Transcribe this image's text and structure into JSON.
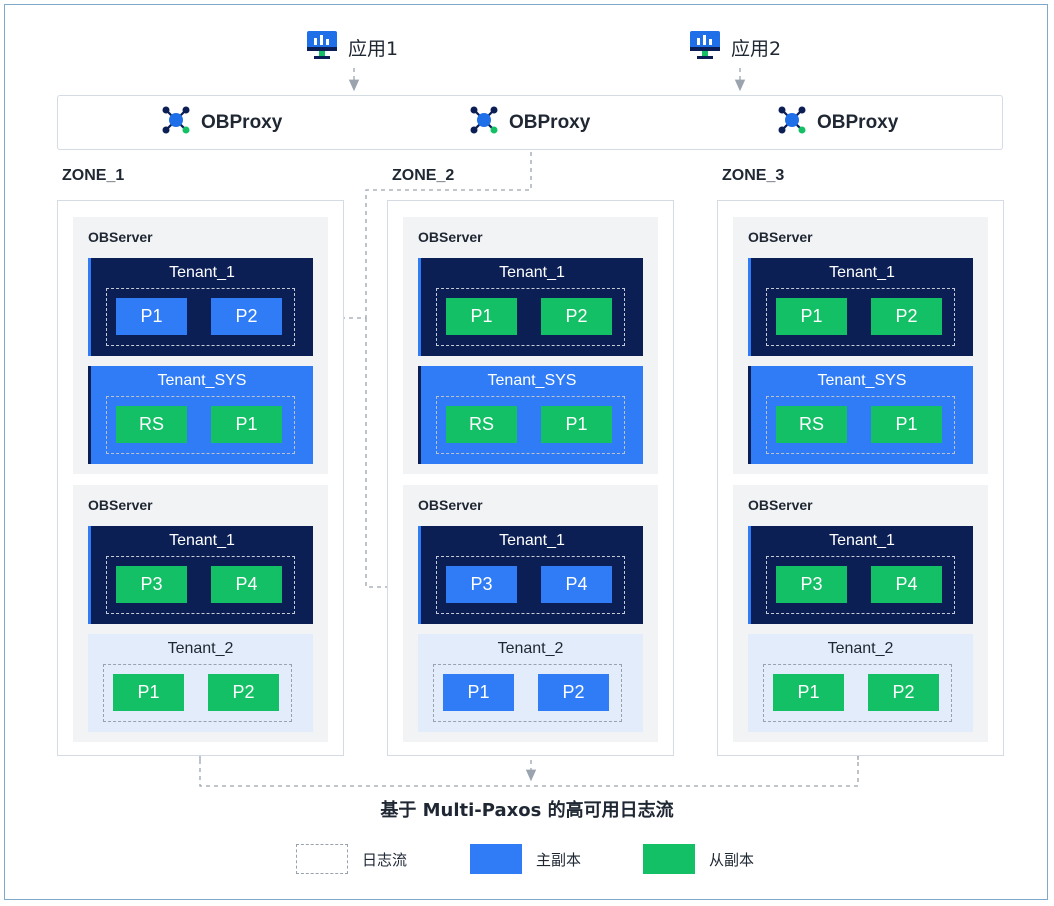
{
  "apps": [
    {
      "label": "应用1",
      "icon": "monitor-icon"
    },
    {
      "label": "应用2",
      "icon": "monitor-icon"
    }
  ],
  "proxies": [
    {
      "label": "OBProxy",
      "icon": "network-node-icon"
    },
    {
      "label": "OBProxy",
      "icon": "network-node-icon"
    },
    {
      "label": "OBProxy",
      "icon": "network-node-icon"
    }
  ],
  "zones": [
    {
      "name": "ZONE_1",
      "servers": [
        {
          "title": "OBServer",
          "tenants": [
            {
              "name": "Tenant_1",
              "style": "dark",
              "partitions": [
                {
                  "label": "P1",
                  "role": "leader"
                },
                {
                  "label": "P2",
                  "role": "leader"
                }
              ]
            },
            {
              "name": "Tenant_SYS",
              "style": "blue",
              "partitions": [
                {
                  "label": "RS",
                  "role": "follower"
                },
                {
                  "label": "P1",
                  "role": "follower"
                }
              ]
            }
          ]
        },
        {
          "title": "OBServer",
          "tenants": [
            {
              "name": "Tenant_1",
              "style": "dark",
              "partitions": [
                {
                  "label": "P3",
                  "role": "follower"
                },
                {
                  "label": "P4",
                  "role": "follower"
                }
              ]
            },
            {
              "name": "Tenant_2",
              "style": "light",
              "partitions": [
                {
                  "label": "P1",
                  "role": "follower"
                },
                {
                  "label": "P2",
                  "role": "follower"
                }
              ]
            }
          ]
        }
      ]
    },
    {
      "name": "ZONE_2",
      "servers": [
        {
          "title": "OBServer",
          "tenants": [
            {
              "name": "Tenant_1",
              "style": "dark",
              "partitions": [
                {
                  "label": "P1",
                  "role": "follower"
                },
                {
                  "label": "P2",
                  "role": "follower"
                }
              ]
            },
            {
              "name": "Tenant_SYS",
              "style": "blue",
              "partitions": [
                {
                  "label": "RS",
                  "role": "follower"
                },
                {
                  "label": "P1",
                  "role": "follower"
                }
              ]
            }
          ]
        },
        {
          "title": "OBServer",
          "tenants": [
            {
              "name": "Tenant_1",
              "style": "dark",
              "partitions": [
                {
                  "label": "P3",
                  "role": "leader"
                },
                {
                  "label": "P4",
                  "role": "leader"
                }
              ]
            },
            {
              "name": "Tenant_2",
              "style": "light",
              "partitions": [
                {
                  "label": "P1",
                  "role": "leader"
                },
                {
                  "label": "P2",
                  "role": "leader"
                }
              ]
            }
          ]
        }
      ]
    },
    {
      "name": "ZONE_3",
      "servers": [
        {
          "title": "OBServer",
          "tenants": [
            {
              "name": "Tenant_1",
              "style": "dark",
              "partitions": [
                {
                  "label": "P1",
                  "role": "follower"
                },
                {
                  "label": "P2",
                  "role": "follower"
                }
              ]
            },
            {
              "name": "Tenant_SYS",
              "style": "blue",
              "partitions": [
                {
                  "label": "RS",
                  "role": "follower"
                },
                {
                  "label": "P1",
                  "role": "follower"
                }
              ]
            }
          ]
        },
        {
          "title": "OBServer",
          "tenants": [
            {
              "name": "Tenant_1",
              "style": "dark",
              "partitions": [
                {
                  "label": "P3",
                  "role": "follower"
                },
                {
                  "label": "P4",
                  "role": "follower"
                }
              ]
            },
            {
              "name": "Tenant_2",
              "style": "light",
              "partitions": [
                {
                  "label": "P1",
                  "role": "follower"
                },
                {
                  "label": "P2",
                  "role": "follower"
                }
              ]
            }
          ]
        }
      ]
    }
  ],
  "caption": "基于 Multi-Paxos 的高可用日志流",
  "legend": [
    {
      "label": "日志流",
      "swatch": "dashed-box"
    },
    {
      "label": "主副本",
      "swatch": "blue",
      "color": "#2f7cf6"
    },
    {
      "label": "从副本",
      "swatch": "green",
      "color": "#14c065"
    }
  ],
  "colors": {
    "leader": "#2f7cf6",
    "follower": "#14c065",
    "tenant_dark": "#0b1f55",
    "tenant_light": "#e2ecfa",
    "arrow": "#9aa3ae"
  }
}
